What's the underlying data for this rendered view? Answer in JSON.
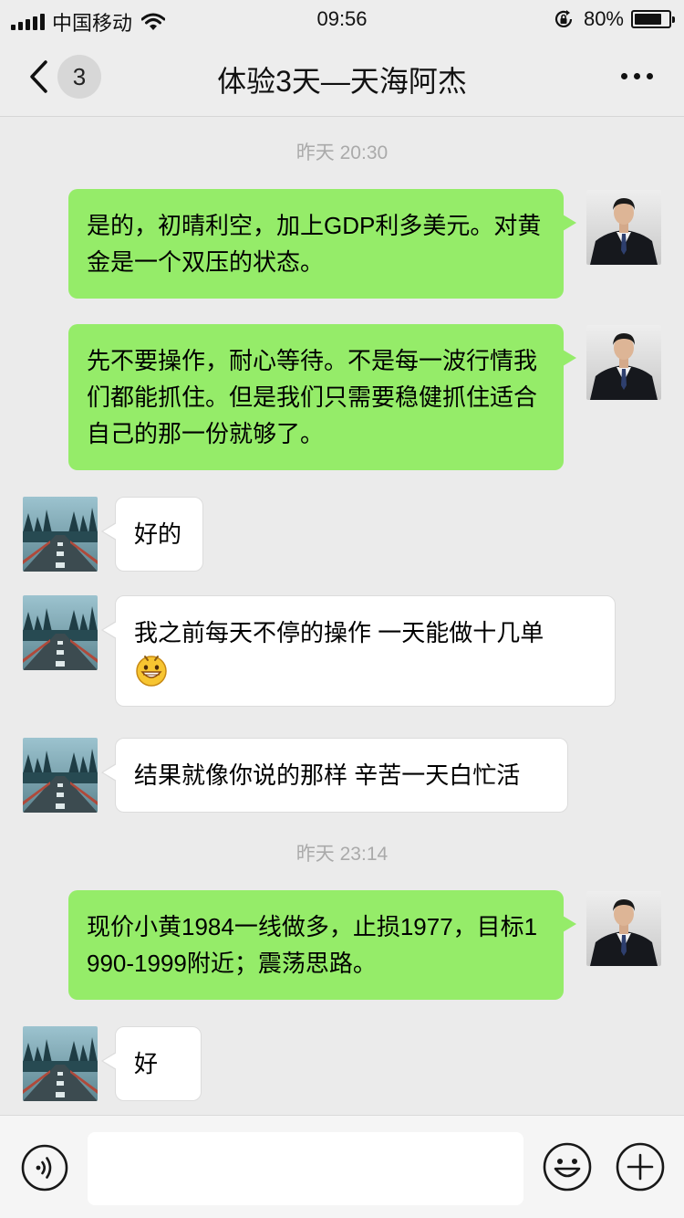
{
  "status_bar": {
    "carrier": "中国移动",
    "time": "09:56",
    "battery_pct": "80%",
    "battery_level": 0.8
  },
  "nav": {
    "unread_count": "3",
    "title": "体验3天—天海阿杰"
  },
  "timestamps": [
    "昨天 20:30",
    "昨天 23:14"
  ],
  "messages": [
    {
      "side": "out",
      "text": "是的，初晴利空，加上GDP利多美元。对黄金是一个双压的状态。"
    },
    {
      "side": "out",
      "text": "先不要操作，耐心等待。不是每一波行情我们都能抓住。但是我们只需要稳健抓住适合自己的那一份就够了。"
    },
    {
      "side": "in",
      "text": "好的"
    },
    {
      "side": "in",
      "text": "我之前每天不停的操作 一天能做十几单",
      "emoji": "grinning-face-emoji"
    },
    {
      "side": "in",
      "text": "结果就像你说的那样 辛苦一天白忙活"
    },
    {
      "side": "out",
      "text": "现价小黄1984一线做多，止损1977，目标1990-1999附近；震荡思路。"
    },
    {
      "side": "in",
      "text": "好"
    }
  ],
  "input_bar": {
    "value": "",
    "placeholder": ""
  },
  "colors": {
    "outgoing_bubble": "#95ec69",
    "incoming_bubble": "#ffffff",
    "chat_background": "#ebebeb"
  }
}
